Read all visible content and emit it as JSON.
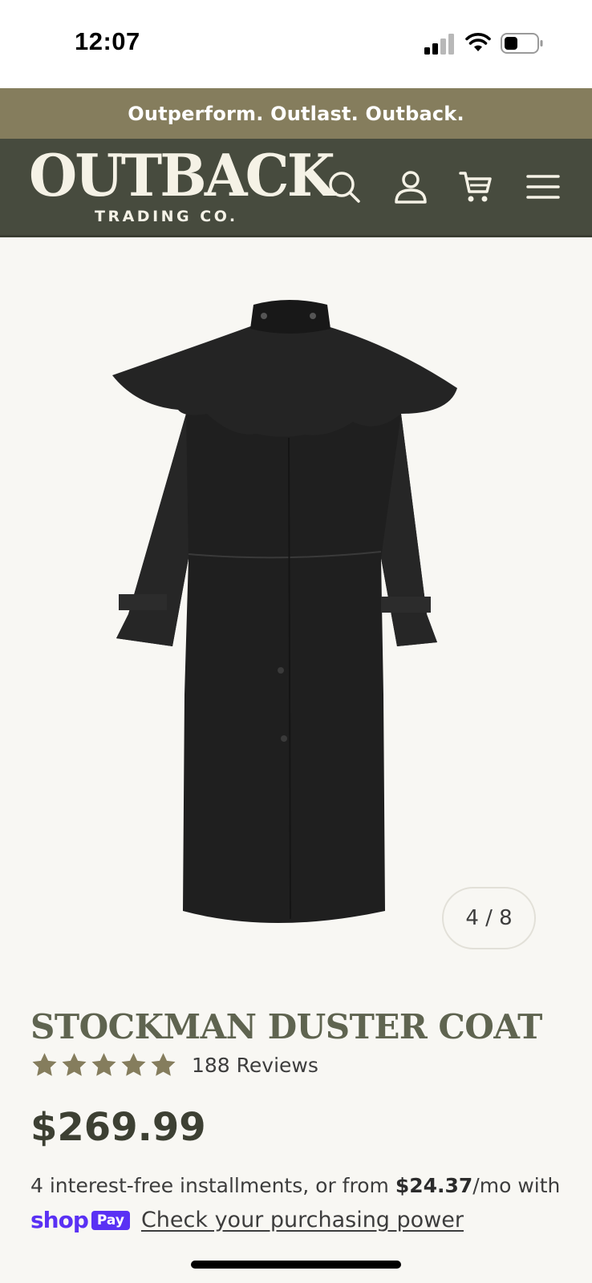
{
  "status_bar": {
    "time": "12:07",
    "icons": [
      "cellular-signal-icon",
      "wifi-icon",
      "battery-icon"
    ]
  },
  "promo": {
    "text": "Outperform. Outlast. Outback."
  },
  "header": {
    "logo_main": "OUTBACK",
    "logo_sub": "TRADING CO.",
    "icons": [
      "search-icon",
      "account-icon",
      "cart-icon",
      "menu-icon"
    ]
  },
  "gallery": {
    "counter": "4 / 8"
  },
  "product": {
    "title": "STOCKMAN DUSTER COAT",
    "rating": 5,
    "reviews": "188 Reviews",
    "price": "$269.99",
    "installments_prefix": "4 interest-free installments, or from ",
    "installments_amount": "$24.37",
    "installments_suffix": "/mo with",
    "shop_word": "shop",
    "pay_badge": "Pay",
    "purchasing_power_link": "Check your purchasing power"
  },
  "colors": {
    "promo_bg": "#857d5d",
    "header_bg": "#474b3e",
    "title": "#5f6450",
    "star": "#857d5d",
    "shop_pay": "#5a31f4"
  }
}
